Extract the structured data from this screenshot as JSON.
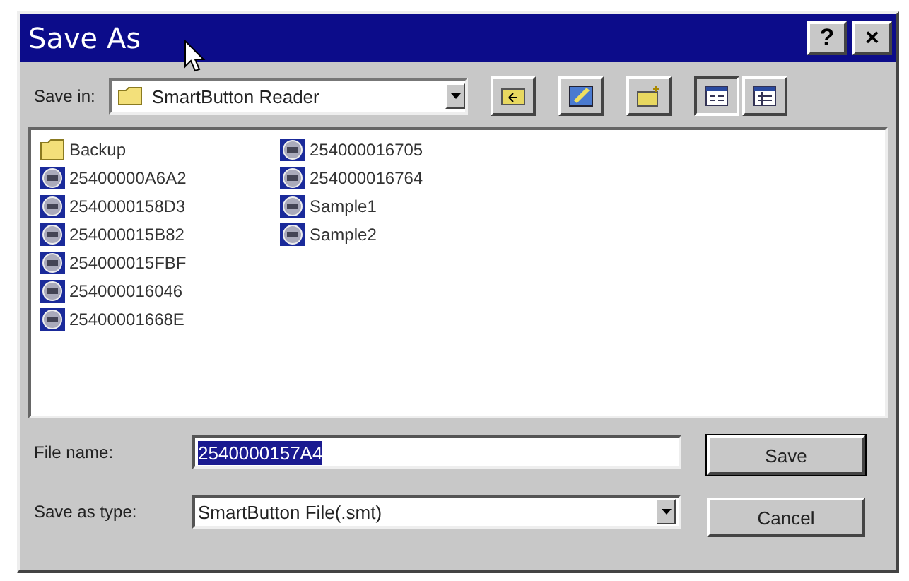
{
  "window": {
    "title": "Save As",
    "buttons": [
      "?",
      "×"
    ]
  },
  "save_in": {
    "label": "Save in:",
    "value": "SmartButton Reader"
  },
  "files": [
    {
      "name": "Backup",
      "kind": "folder"
    },
    {
      "name": "25400000A6A2",
      "kind": "file"
    },
    {
      "name": "2540000158D3",
      "kind": "file"
    },
    {
      "name": "254000015B82",
      "kind": "file"
    },
    {
      "name": "254000015FBF",
      "kind": "file"
    },
    {
      "name": "254000016046",
      "kind": "file"
    },
    {
      "name": "25400001668E",
      "kind": "file"
    },
    {
      "name": "254000016705",
      "kind": "file"
    },
    {
      "name": "254000016764",
      "kind": "file"
    },
    {
      "name": "Sample1",
      "kind": "file"
    },
    {
      "name": "Sample2",
      "kind": "file"
    }
  ],
  "file_name": {
    "label": "File name:",
    "value": "2540000157A4"
  },
  "save_as_type": {
    "label": "Save as type:",
    "value": "SmartButton File(.smt)"
  },
  "buttons": [
    "Save",
    "Cancel"
  ]
}
